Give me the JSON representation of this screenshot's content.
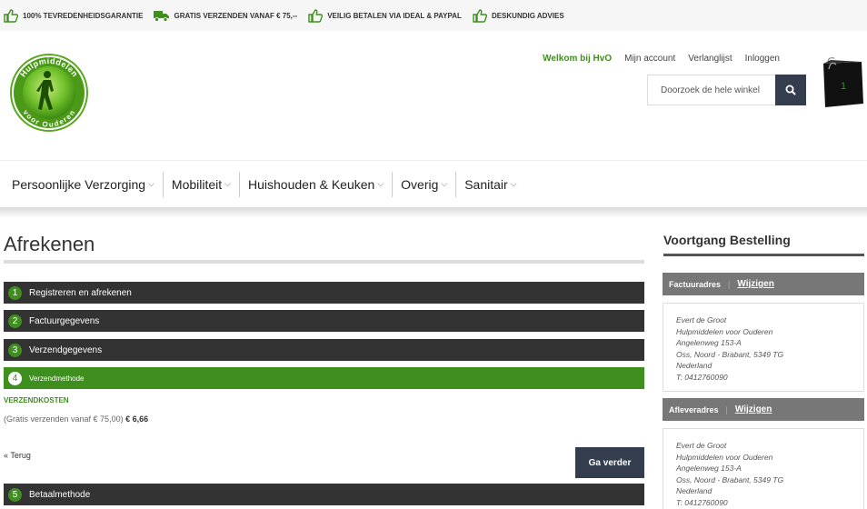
{
  "usp": [
    {
      "icon": "thumbs-up-icon",
      "text": "100% TEVREDENHEIDSGARANTIE"
    },
    {
      "icon": "truck-icon",
      "text": "GRATIS VERZENDEN VANAF € 75,--"
    },
    {
      "icon": "thumbs-up-icon",
      "text": "VEILIG BETALEN VIA IDEAL & PAYPAL"
    },
    {
      "icon": "thumbs-up-icon",
      "text": "DESKUNDIG ADVIES"
    }
  ],
  "logo": {
    "top_text": "Hulpmiddelen",
    "bottom_text": "voor Ouderen"
  },
  "header": {
    "welcome": "Welkom bij HvO",
    "links": [
      "Mijn account",
      "Verlanglijst",
      "Inloggen"
    ],
    "search_placeholder": "Doorzoek de hele winkel",
    "cart_count": "1"
  },
  "nav": [
    {
      "label": "Persoonlijke Verzorging"
    },
    {
      "label": "Mobiliteit"
    },
    {
      "label": "Huishouden & Keuken"
    },
    {
      "label": "Overig"
    },
    {
      "label": "Sanitair"
    }
  ],
  "main": {
    "title": "Afrekenen",
    "steps": [
      {
        "num": "1",
        "label": "Registreren en afrekenen"
      },
      {
        "num": "2",
        "label": "Factuurgegevens"
      },
      {
        "num": "3",
        "label": "Verzendgegevens"
      },
      {
        "num": "4",
        "label": "Verzendmethode"
      },
      {
        "num": "5",
        "label": "Betaalmethode"
      }
    ],
    "shipping_label": "VERZENDKOSTEN",
    "shipping_text": "(Gratis verzenden vanaf € 75,00)",
    "shipping_price": "€ 6,66",
    "back": "« Terug",
    "next": "Ga verder"
  },
  "sidebar": {
    "title": "Voortgang Bestelling",
    "billing": {
      "heading": "Factuuradres",
      "edit": "Wijzigen",
      "lines": [
        "Evert de Groot",
        "Hulpmiddelen voor Ouderen",
        "Angelenweg 153-A",
        "Oss, Noord - Brabant, 5349 TG",
        "Nederland",
        "T: 0412760090"
      ]
    },
    "shipping": {
      "heading": "Afleveradres",
      "edit": "Wijzigen",
      "lines": [
        "Evert de Groot",
        "Hulpmiddelen voor Ouderen",
        "Angelenweg 153-A",
        "Oss, Noord - Brabant, 5349 TG",
        "Nederland",
        "T: 0412760090"
      ]
    }
  },
  "colors": {
    "green": "#3f8f1f",
    "dark": "#333333",
    "navy": "#333d4d",
    "grey": "#777777"
  }
}
